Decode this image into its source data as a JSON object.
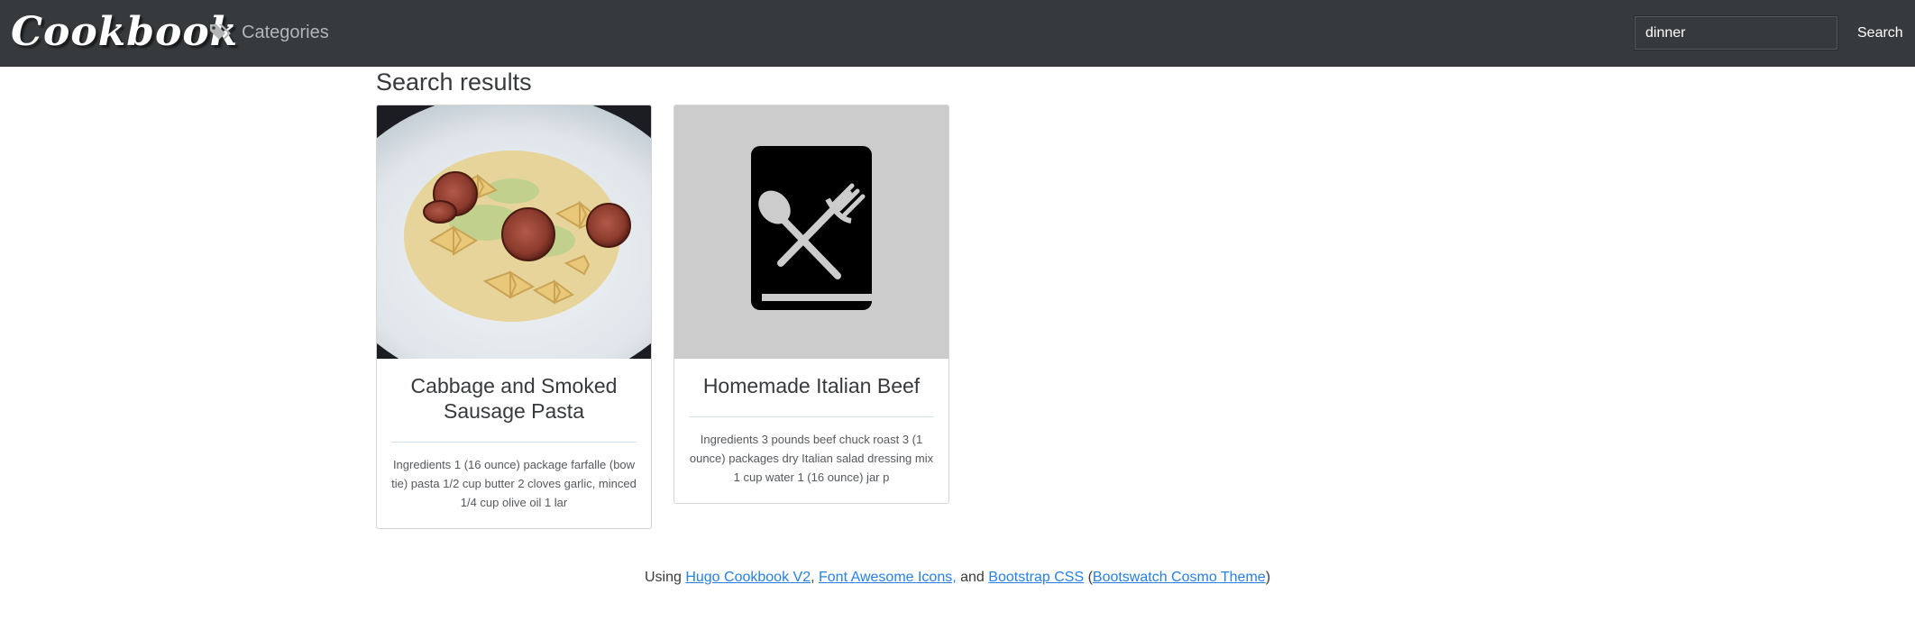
{
  "navbar": {
    "brand": "Cookbook",
    "categories_label": "Categories",
    "categories_icon": "tags-icon",
    "search_value": "dinner",
    "search_button": "Search"
  },
  "main": {
    "heading": "Search results",
    "results": [
      {
        "title": "Cabbage and Smoked Sausage Pasta",
        "excerpt": "Ingredients 1 (16 ounce) package farfalle (bow tie) pasta 1/2 cup butter 2 cloves garlic, minced 1/4 cup olive oil 1 lar",
        "image": "pasta-photo"
      },
      {
        "title": "Homemade Italian Beef",
        "excerpt": "Ingredients 3 pounds beef chuck roast 3 (1 ounce) packages dry Italian salad dressing mix 1 cup water 1 (16 ounce) jar p",
        "image": "cookbook-placeholder-icon"
      }
    ]
  },
  "footer": {
    "prefix": "Using",
    "link1": "Hugo Cookbook V2",
    "sep1": ",",
    "link2": "Font Awesome Icons,",
    "and": "and",
    "link3": "Bootstrap CSS",
    "open_paren": "(",
    "link4": "Bootswatch Cosmo Theme",
    "close_paren": ")"
  },
  "colors": {
    "navbar_bg": "#373a3c",
    "link": "#2780e3",
    "placeholder_bg": "#cccccc"
  }
}
